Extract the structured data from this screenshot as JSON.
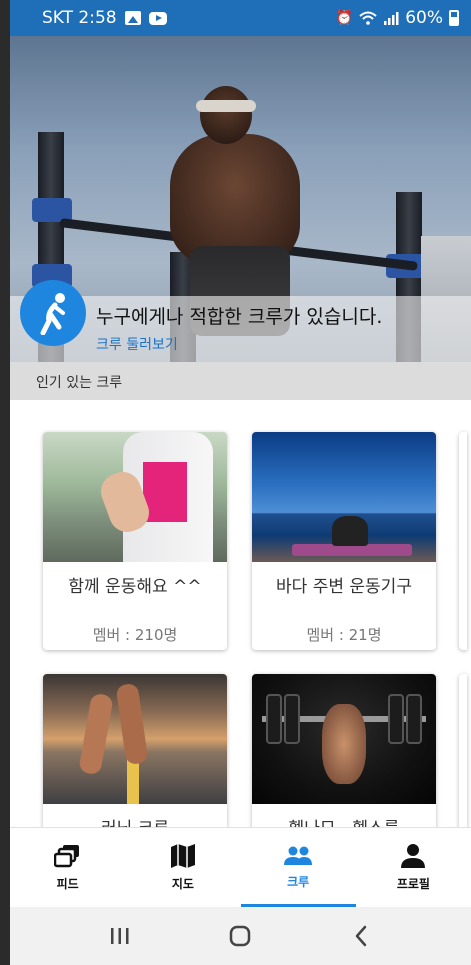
{
  "status_bar": {
    "time": "SKT 2:58",
    "battery": "60%"
  },
  "hero": {
    "title": "누구에게나 적합한 크루가 있습니다.",
    "link": "크루 둘러보기"
  },
  "section": {
    "title": "인기 있는 크루"
  },
  "crews": [
    {
      "name": "함께 운동해요 ^^",
      "members": "멤버 : 210명"
    },
    {
      "name": "바다 주변 운동기구",
      "members": "멤버 : 21명"
    },
    {
      "name": "러닝 크루",
      "members": ""
    },
    {
      "name": "헬나모 - 헬스를",
      "members": ""
    }
  ],
  "bottom_nav": {
    "items": [
      {
        "label": "피드",
        "icon": "feed-icon",
        "active": false
      },
      {
        "label": "지도",
        "icon": "map-icon",
        "active": false
      },
      {
        "label": "크루",
        "icon": "crew-icon",
        "active": true
      },
      {
        "label": "프로필",
        "icon": "profile-icon",
        "active": false
      }
    ]
  },
  "colors": {
    "accent": "#1f86e0",
    "status_bar": "#1f6fb8"
  }
}
